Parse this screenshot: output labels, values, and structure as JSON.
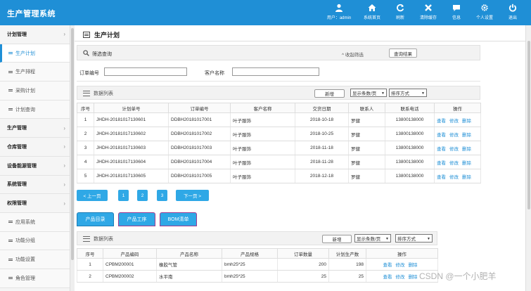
{
  "app": {
    "title": "生产管理系统"
  },
  "topbar": {
    "actions": [
      {
        "icon": "user-icon",
        "label": "用户：admin"
      },
      {
        "icon": "home-icon",
        "label": "系统首页"
      },
      {
        "icon": "refresh-icon",
        "label": "刷新"
      },
      {
        "icon": "clear-cache-icon",
        "label": "清除缓存"
      },
      {
        "icon": "message-icon",
        "label": "信息"
      },
      {
        "icon": "gear-icon",
        "label": "个人设置"
      },
      {
        "icon": "exit-icon",
        "label": "退出"
      }
    ]
  },
  "sidebar": {
    "items": [
      {
        "label": "计划管理",
        "type": "group"
      },
      {
        "label": "生产计划",
        "type": "sub",
        "active": true
      },
      {
        "label": "生产排程",
        "type": "sub"
      },
      {
        "label": "采购计划",
        "type": "sub"
      },
      {
        "label": "计划查询",
        "type": "sub"
      },
      {
        "label": "生产管理",
        "type": "group"
      },
      {
        "label": "仓库管理",
        "type": "group"
      },
      {
        "label": "设备能源管理",
        "type": "group"
      },
      {
        "label": "系统管理",
        "type": "group"
      },
      {
        "label": "权限管理",
        "type": "group"
      },
      {
        "label": "应用系统",
        "type": "sub"
      },
      {
        "label": "功能分组",
        "type": "sub"
      },
      {
        "label": "功能设置",
        "type": "sub"
      },
      {
        "label": "角色管理",
        "type": "sub"
      }
    ]
  },
  "page": {
    "title": "生产计划"
  },
  "filter": {
    "label": "筛选查询",
    "collapse_label": "收起筛选",
    "result_button": "查询结果",
    "order_no_label": "订单编号",
    "order_no_value": "",
    "customer_label": "客户名称",
    "customer_value": ""
  },
  "plan_list": {
    "label": "数据列表",
    "add_button": "新增",
    "page_size_select": "显示条数/页",
    "sort_select": "排序方式",
    "columns": [
      "序号",
      "计划单号",
      "订单编号",
      "客户名称",
      "交货日期",
      "联系人",
      "联系电话",
      "操作"
    ],
    "rows": [
      {
        "no": "1",
        "plan_no": "JHDH-20181017130601",
        "order_no": "DDBH20181017001",
        "customer": "叶子服饰",
        "date": "2018-10-18",
        "contact": "罗健",
        "phone": "13800138000"
      },
      {
        "no": "2",
        "plan_no": "JHDH-20181017130602",
        "order_no": "DDBH20181017002",
        "customer": "叶子服饰",
        "date": "2018-10-25",
        "contact": "罗健",
        "phone": "13800138000"
      },
      {
        "no": "3",
        "plan_no": "JHDH-20181017130603",
        "order_no": "DDBH20181017003",
        "customer": "叶子服饰",
        "date": "2018-11-18",
        "contact": "罗健",
        "phone": "13800138000"
      },
      {
        "no": "4",
        "plan_no": "JHDH-20181017130604",
        "order_no": "DDBH20181017004",
        "customer": "叶子服饰",
        "date": "2018-11-28",
        "contact": "罗健",
        "phone": "13800138000"
      },
      {
        "no": "5",
        "plan_no": "JHDH-20181017130605",
        "order_no": "DDBH20181017005",
        "customer": "叶子服饰",
        "date": "2018-12-18",
        "contact": "罗健",
        "phone": "13800138000"
      }
    ],
    "ops": {
      "view": "查看",
      "edit": "修改",
      "delete": "删除"
    }
  },
  "pager": {
    "prev": "< 上一页",
    "pages": [
      "1",
      "2",
      "3"
    ],
    "next": "下一页 >"
  },
  "tabs": [
    {
      "label": "产品目录",
      "active": false
    },
    {
      "label": "产品工序",
      "active": true
    },
    {
      "label": "BOM清单",
      "active": true
    }
  ],
  "product_list": {
    "label": "数据列表",
    "add_button": "新增",
    "page_size_select": "显示条数/页",
    "sort_select": "排序方式",
    "columns": [
      "序号",
      "产品编码",
      "产品名称",
      "产品规格",
      "订单数量",
      "计划生产数",
      "操作"
    ],
    "rows": [
      {
        "no": "1",
        "code": "CPBM200001",
        "name": "橡胶气管",
        "spec": "bmh25*25",
        "qty": "200",
        "plan_qty": "198"
      },
      {
        "no": "2",
        "code": "CPBM200002",
        "name": "水平南",
        "spec": "bmh25*25",
        "qty": "25",
        "plan_qty": "25"
      }
    ],
    "ops": {
      "view": "查看",
      "edit": "修改",
      "delete": "删除"
    }
  },
  "watermark": "CSDN @一个小肥羊"
}
